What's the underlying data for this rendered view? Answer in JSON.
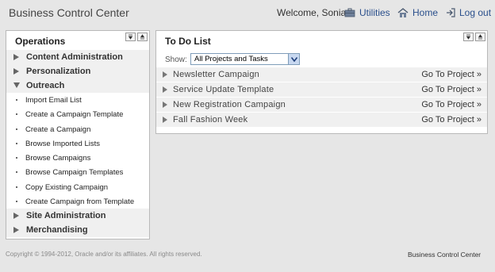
{
  "header": {
    "app_title": "Business Control Center",
    "welcome": "Welcome, Sonia",
    "utilities": "Utilities",
    "home": "Home",
    "logout": "Log out",
    "link_color": "#2a4f8c"
  },
  "operations": {
    "title": "Operations",
    "sections": [
      "Content Administration",
      "Personalization",
      "Outreach",
      "Site Administration",
      "Merchandising"
    ],
    "expanded_section": "Outreach",
    "items": [
      "Import Email List",
      "Create a Campaign Template",
      "Create a Campaign",
      "Browse Imported Lists",
      "Browse Campaigns",
      "Browse Campaign Templates",
      "Copy Existing Campaign",
      "Create Campaign from Template"
    ]
  },
  "todo": {
    "title": "To Do List",
    "show_label": "Show:",
    "show_value": "All Projects and Tasks",
    "rows": [
      {
        "name": "Newsletter Campaign",
        "action": "Go To Project »"
      },
      {
        "name": "Service Update Template",
        "action": "Go To Project »"
      },
      {
        "name": "New Registration Campaign",
        "action": "Go To Project »"
      },
      {
        "name": "Fall Fashion Week",
        "action": "Go To Project »"
      }
    ]
  },
  "footer": {
    "copyright": "Copyright © 1994-2012, Oracle and/or its affiliates. All rights reserved.",
    "brand": "Business Control Center"
  },
  "icons": {
    "utilities": "toolbox-icon",
    "home": "house-icon",
    "logout": "logout-arrow-icon",
    "panel_minimize": "minimize-icon",
    "panel_close": "collapse-icon"
  }
}
